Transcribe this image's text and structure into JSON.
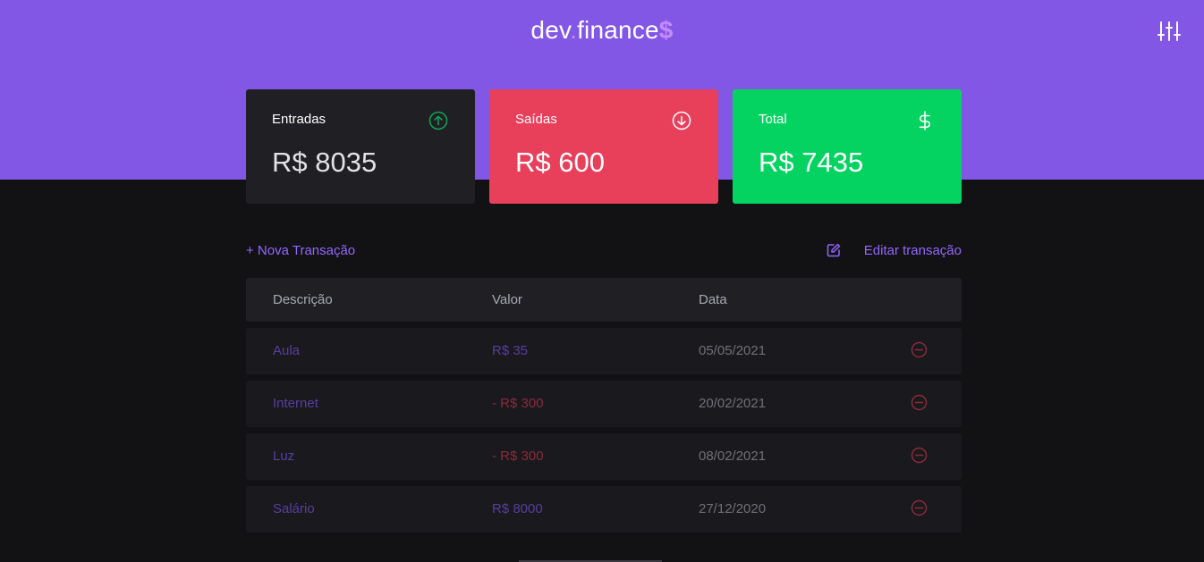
{
  "header": {
    "logo_dev": "dev",
    "logo_dot": ".",
    "logo_finance": "finance",
    "logo_dollar": "$",
    "settings_icon": "sliders-icon",
    "brand_color": "#8257e5"
  },
  "cards": {
    "income": {
      "label": "Entradas",
      "amount": "R$ 8035",
      "icon": "arrow-up-circle-icon"
    },
    "expense": {
      "label": "Saídas",
      "amount": "R$ 600",
      "icon": "arrow-down-circle-icon"
    },
    "total": {
      "label": "Total",
      "amount": "R$ 7435",
      "icon": "dollar-icon"
    }
  },
  "actions": {
    "new_transaction": "+ Nova Transação",
    "edit_transaction": "Editar transação"
  },
  "table": {
    "headers": [
      "Descrição",
      "Valor",
      "Data"
    ],
    "rows": [
      {
        "description": "Aula",
        "value": "R$ 35",
        "date": "05/05/2021",
        "type": "income"
      },
      {
        "description": "Internet",
        "value": "- R$ 300",
        "date": "20/02/2021",
        "type": "expense"
      },
      {
        "description": "Luz",
        "value": "- R$ 300",
        "date": "08/02/2021",
        "type": "expense"
      },
      {
        "description": "Salário",
        "value": "R$ 8000",
        "date": "27/12/2020",
        "type": "income"
      }
    ]
  },
  "colors": {
    "income": "#04d361",
    "expense": "#e83f5b",
    "accent": "#9466ff"
  }
}
